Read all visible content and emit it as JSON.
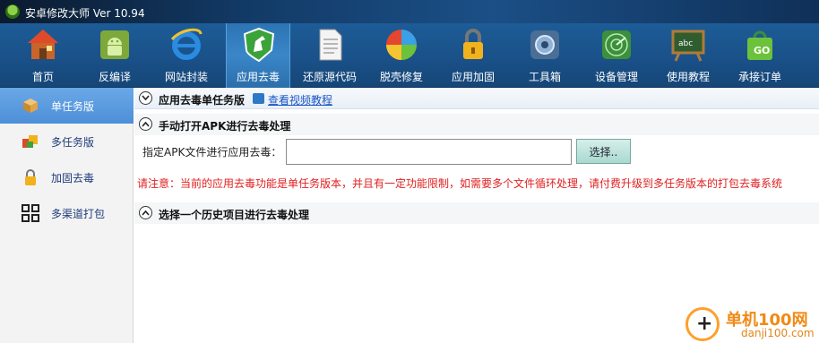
{
  "window": {
    "title": "安卓修改大师 Ver 10.94"
  },
  "toolbar": {
    "items": [
      {
        "label": "首页",
        "icon": "home-icon"
      },
      {
        "label": "反编译",
        "icon": "android-icon"
      },
      {
        "label": "网站封装",
        "icon": "ie-icon"
      },
      {
        "label": "应用去毒",
        "icon": "shield-horse-icon",
        "active": true
      },
      {
        "label": "还原源代码",
        "icon": "document-icon"
      },
      {
        "label": "脱壳修复",
        "icon": "pie-icon"
      },
      {
        "label": "应用加固",
        "icon": "lock-icon"
      },
      {
        "label": "工具箱",
        "icon": "toolbox-icon"
      },
      {
        "label": "设备管理",
        "icon": "radar-icon"
      },
      {
        "label": "使用教程",
        "icon": "blackboard-icon"
      },
      {
        "label": "承接订单",
        "icon": "go-bag-icon"
      }
    ]
  },
  "sidebar": {
    "items": [
      {
        "label": "单任务版",
        "icon": "box-icon",
        "active": true
      },
      {
        "label": "多任务版",
        "icon": "boxes-icon"
      },
      {
        "label": "加固去毒",
        "icon": "lock-icon"
      },
      {
        "label": "多渠道打包",
        "icon": "grid-icon"
      }
    ]
  },
  "main": {
    "header": {
      "title": "应用去毒单任务版",
      "video_link": "查看视频教程"
    },
    "section_manual": {
      "title": "手动打开APK进行去毒处理",
      "field_label": "指定APK文件进行应用去毒：",
      "input_value": "",
      "choose_button": "选择.."
    },
    "notice": "请注意：当前的应用去毒功能是单任务版本，并且有一定功能限制，如需要多个文件循环处理，请付费升级到多任务版本的打包去毒系统",
    "section_history": {
      "title": "选择一个历史项目进行去毒处理"
    }
  },
  "watermark": {
    "name": "单机100网",
    "url": "danji100.com"
  },
  "colors": {
    "toolbar": "#1a5189",
    "sidebar_active": "#4d8fd8",
    "notice": "#e02020",
    "link": "#1a56c4"
  }
}
